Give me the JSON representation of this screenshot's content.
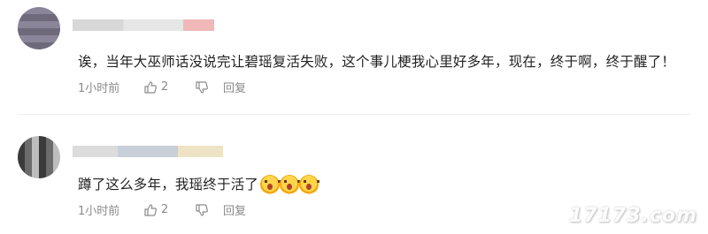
{
  "comments": [
    {
      "text": "诶，当年大巫师话没说完让碧瑶复活失败，这个事儿梗我心里好多年，现在，终于啊，终于醒了！",
      "time": "1小时前",
      "likes": "2",
      "reply_label": "回复"
    },
    {
      "text": "蹲了这么多年，我瑶终于活了",
      "emoji": "shocked-face-emoji",
      "emoji_count": 3,
      "time": "1小时前",
      "likes": "2",
      "reply_label": "回复"
    }
  ],
  "watermark": "17173.com",
  "colors": {
    "text": "#222222",
    "meta": "#8a8a8a",
    "divider": "#eeeeee"
  }
}
